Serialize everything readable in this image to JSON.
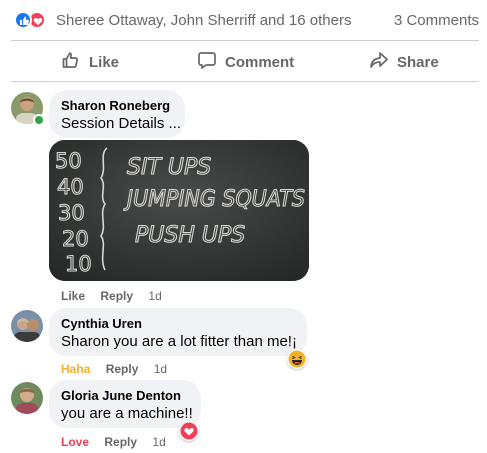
{
  "summary": {
    "reactors": "Sheree Ottaway, John Sherriff and 16 others",
    "comment_count": "3 Comments",
    "reaction_icons": [
      "like-icon",
      "love-icon"
    ]
  },
  "actions": {
    "like": "Like",
    "comment": "Comment",
    "share": "Share"
  },
  "comments": [
    {
      "author": "Sharon Roneberg",
      "text": "Session Details ...",
      "online": true,
      "photo_text": {
        "numbers": [
          "50",
          "40",
          "30",
          "20",
          "10"
        ],
        "lines": [
          "SIT UPS",
          "JUMPING SQUATS",
          "PUSH UPS"
        ]
      },
      "like_label": "Like",
      "reply_label": "Reply",
      "time": "1d"
    },
    {
      "author": "Cynthia Uren",
      "text": "Sharon you are a lot fitter than me!¡",
      "reaction_label": "Haha",
      "reaction_color": "#f7b125",
      "reply_label": "Reply",
      "time": "1d",
      "bubble_reaction": "haha-icon"
    },
    {
      "author": "Gloria June Denton",
      "text": "you are a machine!!",
      "reaction_label": "Love",
      "reaction_color": "#f33e58",
      "reply_label": "Reply",
      "time": "1d",
      "bubble_reaction": "love-icon"
    }
  ],
  "colors": {
    "like_blue": "#1877f2",
    "love_red": "#f33e58",
    "haha_yellow": "#f7b125",
    "secondary_text": "#65676b",
    "bubble_bg": "#f0f2f5",
    "online_green": "#31a24c"
  }
}
